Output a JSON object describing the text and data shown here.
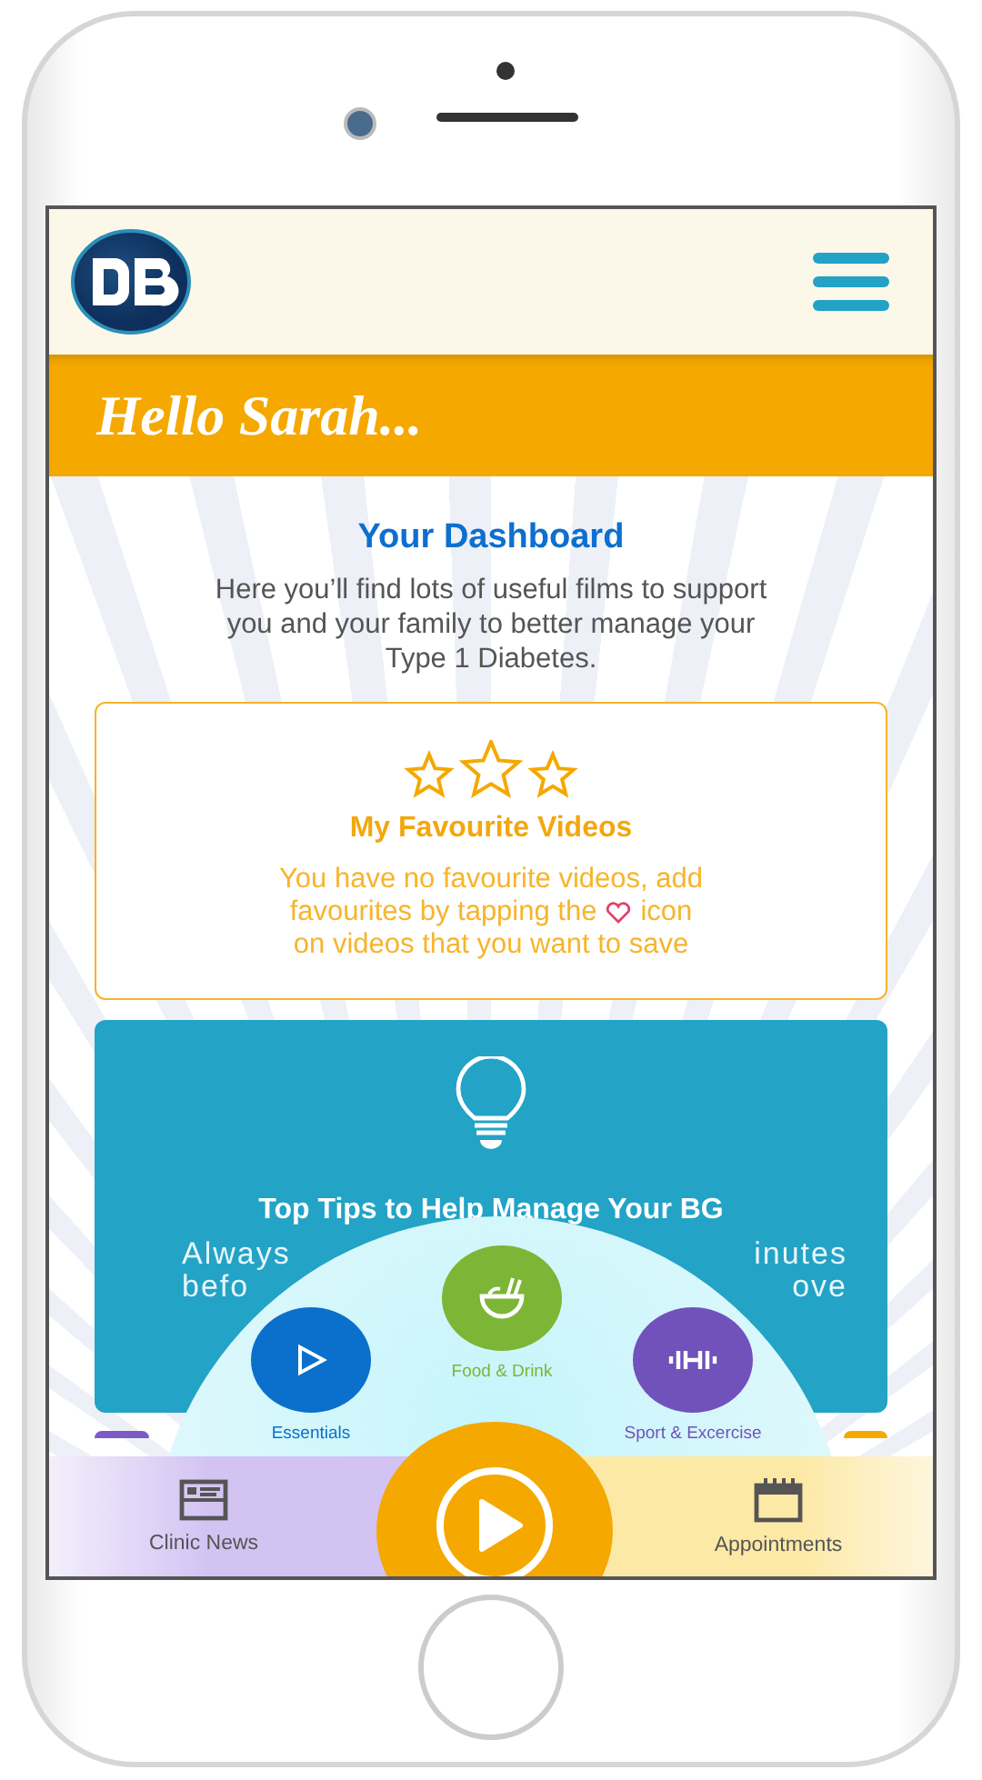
{
  "greeting": "Hello Sarah...",
  "dashboard": {
    "title": "Your Dashboard",
    "description": "Here you’ll find lots of useful films to support you and your family to better manage your Type 1 Diabetes."
  },
  "favourites": {
    "title": "My Favourite Videos",
    "message_lines": [
      [
        "You have no favourite videos, add"
      ],
      [
        "favourites by tapping the",
        "icon"
      ],
      [
        "on videos that you want to save"
      ]
    ]
  },
  "tip_card": {
    "title": "Top Tips to Help Manage Your BG",
    "text_left": [
      "Always",
      "befo"
    ],
    "text_right": [
      "inutes",
      "ove"
    ]
  },
  "categories": [
    {
      "label": "Essentials",
      "color": "#0b6fcc",
      "kind": "play"
    },
    {
      "label": "Food & Drink",
      "color": "#7db536",
      "kind": "food"
    },
    {
      "label": "Sport & Excercise",
      "color": "#7152bb",
      "kind": "sport"
    }
  ],
  "bottom_nav": [
    {
      "label": "Clinic News",
      "kind": "news"
    },
    {
      "label": "Appointments",
      "kind": "calendar"
    }
  ]
}
